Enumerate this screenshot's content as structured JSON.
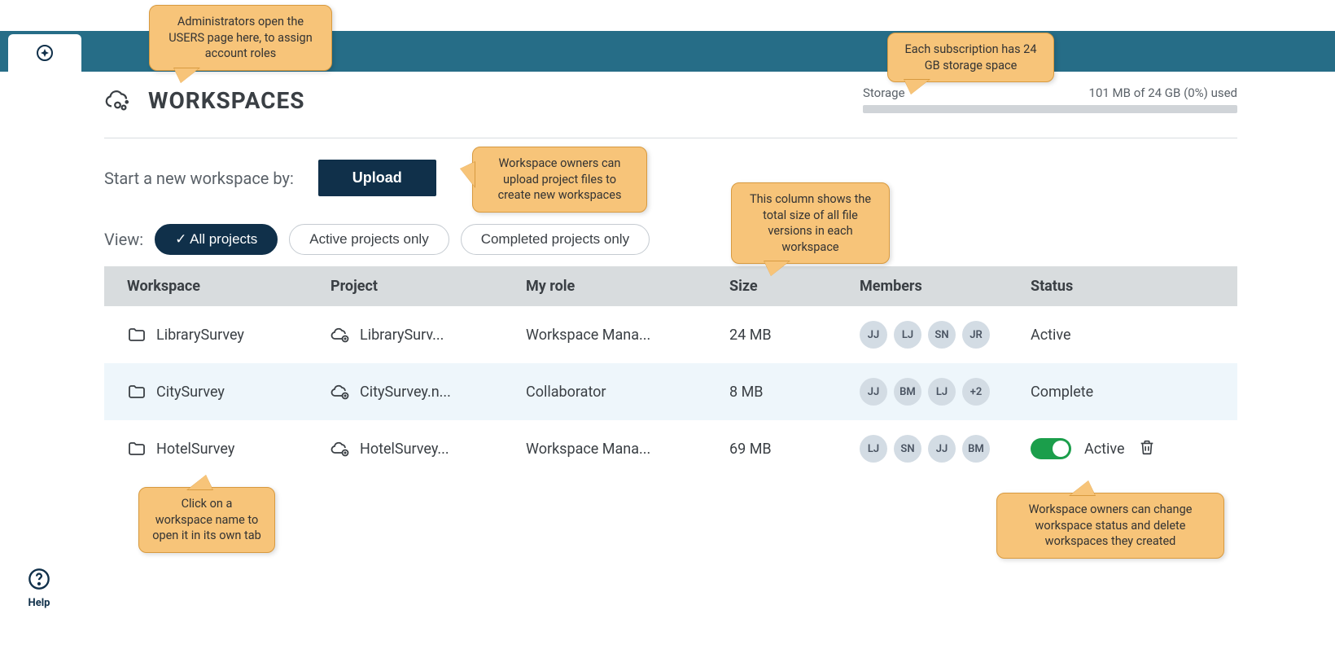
{
  "page_title": "WORKSPACES",
  "storage": {
    "label": "Storage",
    "text": "101 MB of 24 GB (0%) used"
  },
  "upload": {
    "prompt": "Start a new workspace by:",
    "button": "Upload"
  },
  "view": {
    "label": "View:",
    "chips": [
      "All projects",
      "Active projects only",
      "Completed projects only"
    ]
  },
  "columns": {
    "workspace": "Workspace",
    "project": "Project",
    "role": "My role",
    "size": "Size",
    "members": "Members",
    "status": "Status"
  },
  "rows": [
    {
      "workspace": "LibrarySurvey",
      "project": "LibrarySurv...",
      "role": "Workspace Mana...",
      "size": "24 MB",
      "members": [
        "JJ",
        "LJ",
        "SN",
        "JR"
      ],
      "status": "Active",
      "toggle": false,
      "trash": false
    },
    {
      "workspace": "CitySurvey",
      "project": "CitySurvey.n...",
      "role": "Collaborator",
      "size": "8 MB",
      "members": [
        "JJ",
        "BM",
        "LJ",
        "+2"
      ],
      "status": "Complete",
      "toggle": false,
      "trash": false
    },
    {
      "workspace": "HotelSurvey",
      "project": "HotelSurvey...",
      "role": "Workspace Mana...",
      "size": "69 MB",
      "members": [
        "LJ",
        "SN",
        "JJ",
        "BM"
      ],
      "status": "Active",
      "toggle": true,
      "trash": true
    }
  ],
  "help_label": "Help",
  "callouts": {
    "admins": "Administrators open the USERS page here, to assign account roles",
    "storage": "Each subscription has 24 GB storage space",
    "upload": "Workspace owners can upload project files to create new workspaces",
    "size": "This column shows the total size of all file versions in each workspace",
    "click_ws": "Click on a workspace name to open it in its own tab",
    "owner_status": "Workspace owners can change workspace status and delete workspaces they created"
  }
}
